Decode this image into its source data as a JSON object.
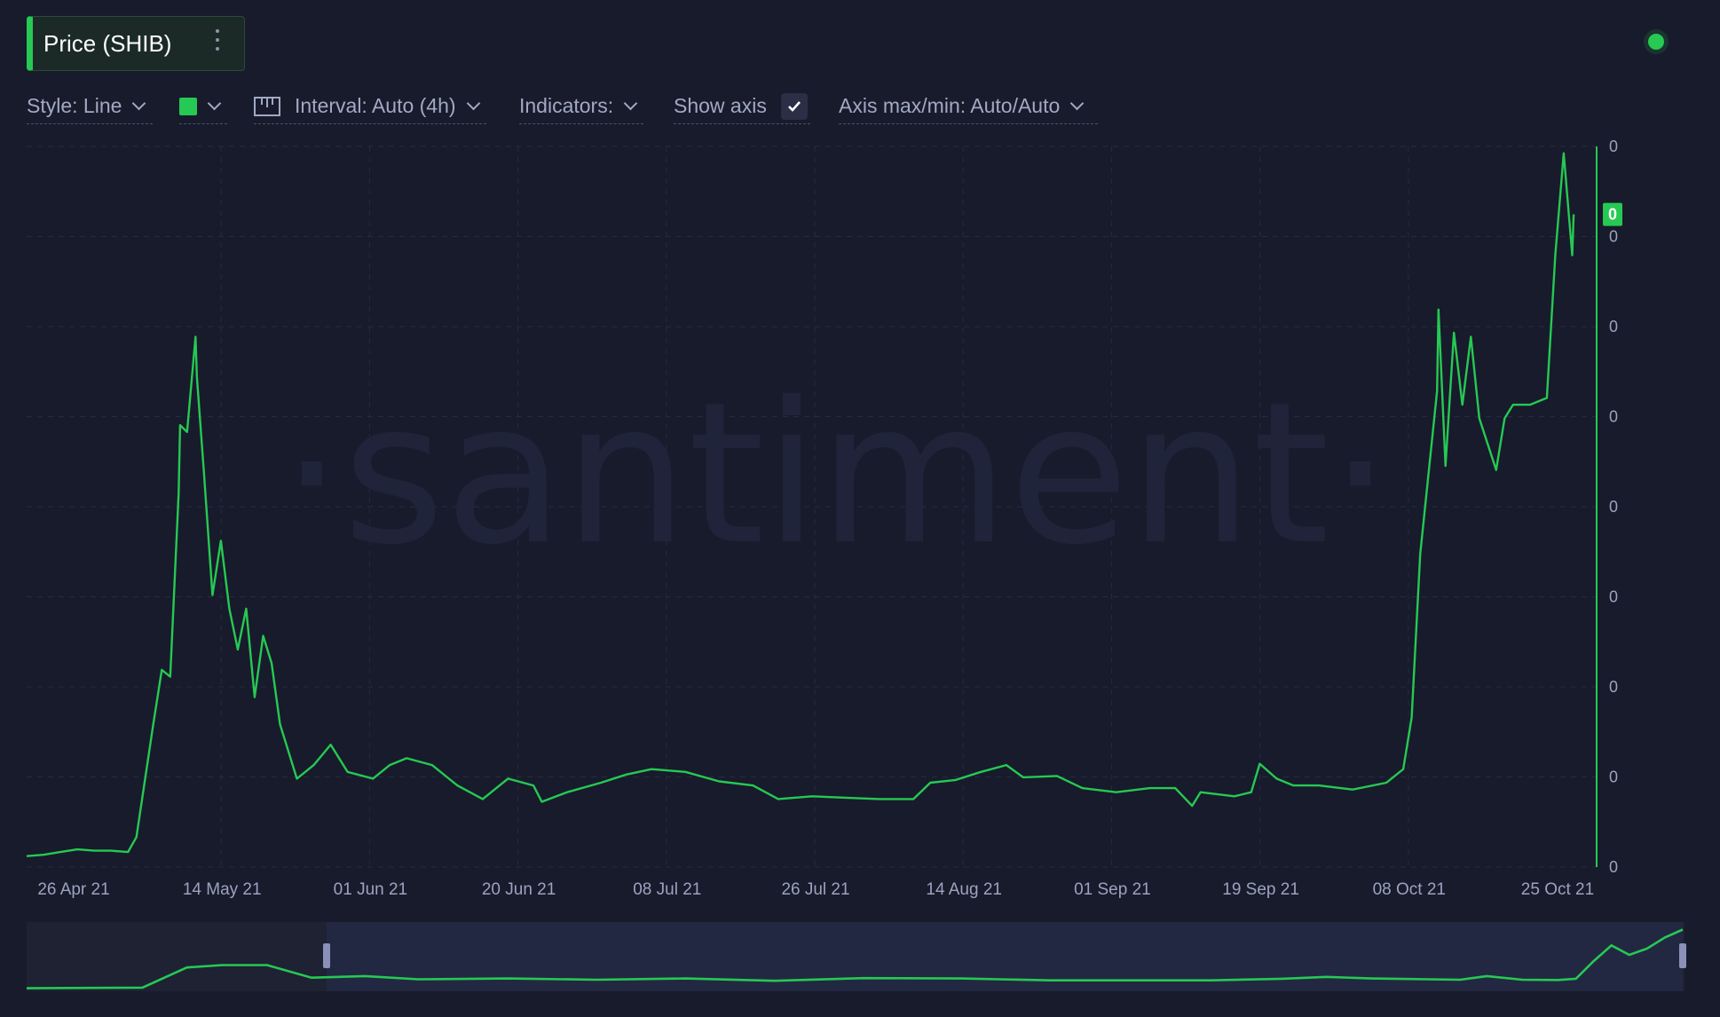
{
  "header": {
    "title": "Price (SHIB)"
  },
  "toolbar": {
    "style_label": "Style: Line",
    "interval_label": "Interval: Auto (4h)",
    "indicators_label": "Indicators:",
    "show_axis_label": "Show axis",
    "axis_maxmin_label": "Axis max/min: Auto/Auto",
    "series_color": "#26c953"
  },
  "watermark": "·santiment·",
  "chart_data": {
    "type": "line",
    "series": [
      {
        "color": "#26c953",
        "points": [
          [
            "2021-04-22",
            8e-07
          ],
          [
            "2021-04-24",
            9e-07
          ],
          [
            "2021-04-26",
            1.1e-06
          ],
          [
            "2021-04-28",
            1.3e-06
          ],
          [
            "2021-04-30",
            1.2e-06
          ],
          [
            "2021-05-02",
            1.2e-06
          ],
          [
            "2021-05-04",
            1.1e-06
          ],
          [
            "2021-05-05",
            2.2e-06
          ],
          [
            "2021-05-07",
            1.05e-05
          ],
          [
            "2021-05-08",
            1.45e-05
          ],
          [
            "2021-05-09",
            1.4e-05
          ],
          [
            "2021-05-10",
            2.75e-05
          ],
          [
            "2021-05-10",
            3.25e-05
          ],
          [
            "2021-05-11",
            3.2e-05
          ],
          [
            "2021-05-12",
            3.9e-05
          ],
          [
            "2021-05-12",
            3.6e-05
          ],
          [
            "2021-05-13",
            2.9e-05
          ],
          [
            "2021-05-14",
            2e-05
          ],
          [
            "2021-05-15",
            2.4e-05
          ],
          [
            "2021-05-16",
            1.9e-05
          ],
          [
            "2021-05-17",
            1.6e-05
          ],
          [
            "2021-05-18",
            1.9e-05
          ],
          [
            "2021-05-19",
            1.25e-05
          ],
          [
            "2021-05-20",
            1.7e-05
          ],
          [
            "2021-05-21",
            1.5e-05
          ],
          [
            "2021-05-22",
            1.05e-05
          ],
          [
            "2021-05-23",
            8.5e-06
          ],
          [
            "2021-05-24",
            6.5e-06
          ],
          [
            "2021-05-26",
            7.5e-06
          ],
          [
            "2021-05-28",
            9e-06
          ],
          [
            "2021-05-30",
            7e-06
          ],
          [
            "2021-06-02",
            6.5e-06
          ],
          [
            "2021-06-04",
            7.5e-06
          ],
          [
            "2021-06-06",
            8e-06
          ],
          [
            "2021-06-09",
            7.5e-06
          ],
          [
            "2021-06-12",
            6e-06
          ],
          [
            "2021-06-15",
            5e-06
          ],
          [
            "2021-06-18",
            6.5e-06
          ],
          [
            "2021-06-21",
            6e-06
          ],
          [
            "2021-06-22",
            4.8e-06
          ],
          [
            "2021-06-25",
            5.5e-06
          ],
          [
            "2021-06-29",
            6.2e-06
          ],
          [
            "2021-07-02",
            6.8e-06
          ],
          [
            "2021-07-05",
            7.2e-06
          ],
          [
            "2021-07-09",
            7e-06
          ],
          [
            "2021-07-13",
            6.3e-06
          ],
          [
            "2021-07-17",
            6e-06
          ],
          [
            "2021-07-20",
            5e-06
          ],
          [
            "2021-07-24",
            5.2e-06
          ],
          [
            "2021-07-28",
            5.1e-06
          ],
          [
            "2021-08-01",
            5e-06
          ],
          [
            "2021-08-05",
            5e-06
          ],
          [
            "2021-08-07",
            6.2e-06
          ],
          [
            "2021-08-10",
            6.4e-06
          ],
          [
            "2021-08-13",
            7e-06
          ],
          [
            "2021-08-16",
            7.5e-06
          ],
          [
            "2021-08-18",
            6.6e-06
          ],
          [
            "2021-08-22",
            6.7e-06
          ],
          [
            "2021-08-25",
            5.8e-06
          ],
          [
            "2021-08-29",
            5.5e-06
          ],
          [
            "2021-09-02",
            5.8e-06
          ],
          [
            "2021-09-05",
            5.8e-06
          ],
          [
            "2021-09-07",
            4.5e-06
          ],
          [
            "2021-09-08",
            5.5e-06
          ],
          [
            "2021-09-12",
            5.2e-06
          ],
          [
            "2021-09-14",
            5.5e-06
          ],
          [
            "2021-09-15",
            7.6e-06
          ],
          [
            "2021-09-17",
            6.5e-06
          ],
          [
            "2021-09-19",
            6e-06
          ],
          [
            "2021-09-22",
            6e-06
          ],
          [
            "2021-09-26",
            5.7e-06
          ],
          [
            "2021-09-30",
            6.2e-06
          ],
          [
            "2021-10-02",
            7.2e-06
          ],
          [
            "2021-10-03",
            1.1e-05
          ],
          [
            "2021-10-04",
            2.3e-05
          ],
          [
            "2021-10-06",
            3.5e-05
          ],
          [
            "2021-10-06",
            4.1e-05
          ],
          [
            "2021-10-07",
            2.95e-05
          ],
          [
            "2021-10-08",
            3.93e-05
          ],
          [
            "2021-10-09",
            3.4e-05
          ],
          [
            "2021-10-10",
            3.9e-05
          ],
          [
            "2021-10-11",
            3.3e-05
          ],
          [
            "2021-10-13",
            2.92e-05
          ],
          [
            "2021-10-14",
            3.3e-05
          ],
          [
            "2021-10-15",
            3.4e-05
          ],
          [
            "2021-10-17",
            3.4e-05
          ],
          [
            "2021-10-19",
            3.45e-05
          ],
          [
            "2021-10-20",
            4.5e-05
          ],
          [
            "2021-10-21",
            5.25e-05
          ],
          [
            "2021-10-22",
            4.5e-05
          ],
          [
            "2021-10-22",
            4.8e-05
          ]
        ]
      }
    ],
    "x_ticks": [
      "26 Apr 21",
      "14 May 21",
      "01 Jun 21",
      "20 Jun 21",
      "08 Jul 21",
      "26 Jul 21",
      "14 Aug 21",
      "01 Sep 21",
      "19 Sep 21",
      "08 Oct 21",
      "25 Oct 21"
    ],
    "y_ticks": [
      "0",
      "0",
      "0",
      "0",
      "0",
      "0",
      "0",
      "0",
      "0"
    ],
    "last_value_label": "0",
    "xlim": [
      "2021-04-22",
      "2021-10-25"
    ],
    "ylim": [
      0,
      5.3e-05
    ],
    "grid": true,
    "axis_side": "right",
    "navigator": {
      "points": [
        [
          "2021-04-22",
          8e-07
        ],
        [
          "2021-05-05",
          1.2e-06
        ],
        [
          "2021-05-10",
          1.4e-05
        ],
        [
          "2021-05-14",
          1.55e-05
        ],
        [
          "2021-05-19",
          1.55e-05
        ],
        [
          "2021-05-24",
          7.5e-06
        ],
        [
          "2021-05-30",
          8.5e-06
        ],
        [
          "2021-06-05",
          6.5e-06
        ],
        [
          "2021-06-15",
          7e-06
        ],
        [
          "2021-06-25",
          6.2e-06
        ],
        [
          "2021-07-05",
          7e-06
        ],
        [
          "2021-07-15",
          5.5e-06
        ],
        [
          "2021-07-25",
          7.2e-06
        ],
        [
          "2021-08-05",
          7e-06
        ],
        [
          "2021-08-15",
          5.8e-06
        ],
        [
          "2021-08-25",
          5.8e-06
        ],
        [
          "2021-09-02",
          5.8e-06
        ],
        [
          "2021-09-10",
          6.8e-06
        ],
        [
          "2021-09-15",
          8e-06
        ],
        [
          "2021-09-20",
          7e-06
        ],
        [
          "2021-09-30",
          6.2e-06
        ],
        [
          "2021-10-03",
          8.5e-06
        ],
        [
          "2021-10-07",
          6.2e-06
        ],
        [
          "2021-10-11",
          6e-06
        ],
        [
          "2021-10-13",
          6.8e-06
        ],
        [
          "2021-10-15",
          1.8e-05
        ],
        [
          "2021-10-17",
          2.8e-05
        ],
        [
          "2021-10-19",
          2.2e-05
        ],
        [
          "2021-10-21",
          2.6e-05
        ],
        [
          "2021-10-23",
          3.3e-05
        ],
        [
          "2021-10-25",
          3.8e-05
        ]
      ],
      "selection_start": "2021-04-22",
      "selection_end": "2021-10-25"
    }
  }
}
